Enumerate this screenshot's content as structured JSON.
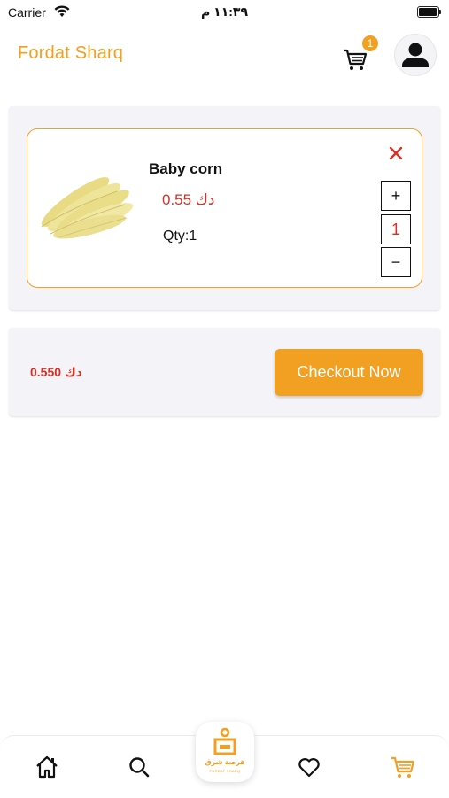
{
  "status_bar": {
    "carrier": "Carrier",
    "time": "١١:٣٩ م"
  },
  "header": {
    "title": "Fordat Sharq",
    "cart_count": "1",
    "cart_icon": "shopping-cart-icon",
    "profile_icon": "person-icon"
  },
  "cart": {
    "items": [
      {
        "name": "Baby corn",
        "price": "0.55 دك",
        "qty_label": "Qty:1",
        "quantity": "1",
        "plus_label": "+",
        "minus_label": "−",
        "remove_icon": "close-icon",
        "image": "baby-corn-image"
      }
    ]
  },
  "summary": {
    "total": "0.550 دك",
    "checkout_label": "Checkout Now"
  },
  "bottom_nav": {
    "items": [
      {
        "icon": "home-icon"
      },
      {
        "icon": "search-icon"
      },
      {
        "icon": "heart-icon"
      },
      {
        "icon": "cart-icon",
        "active": true
      }
    ],
    "logo_text_ar": "فرصة شرق",
    "logo_text_en": "FORDAT SHARQ"
  },
  "colors": {
    "accent": "#F2A022",
    "price_red": "#D93025",
    "panel_bg": "#f4f4f8"
  }
}
